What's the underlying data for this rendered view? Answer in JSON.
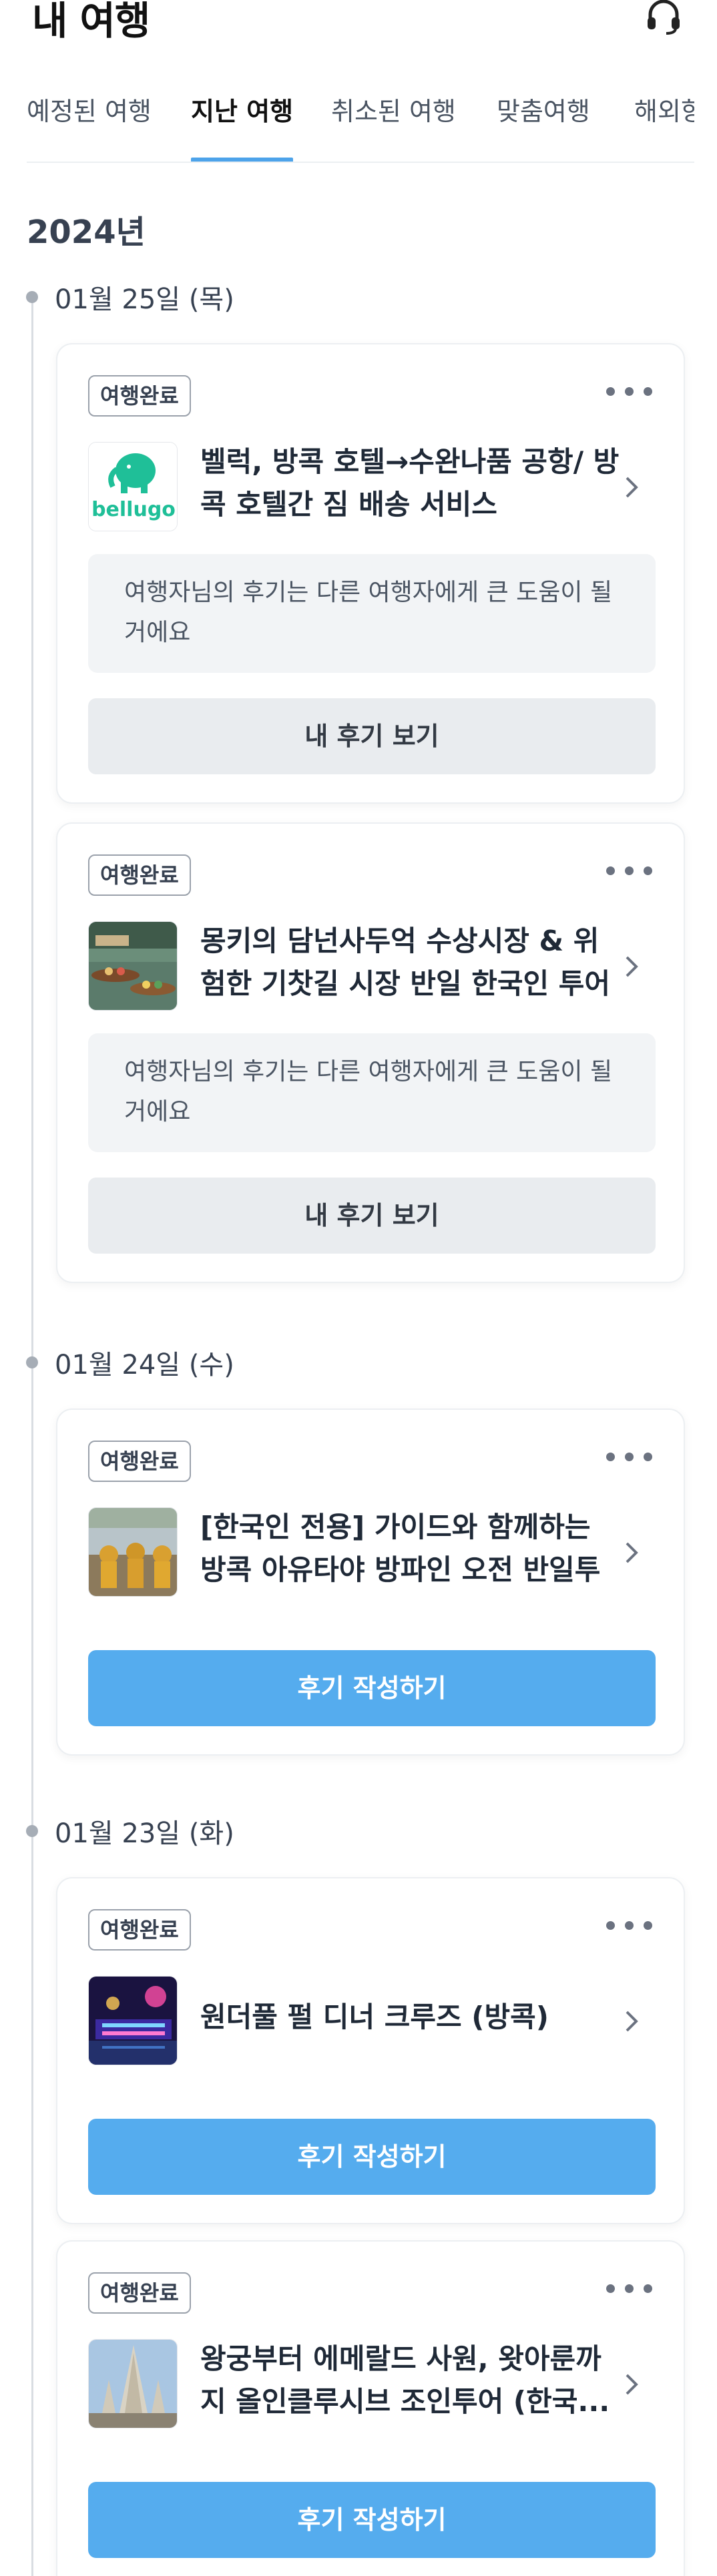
{
  "header": {
    "title": "내 여행",
    "support_icon": "headset-icon"
  },
  "tabs": [
    {
      "label": "예정된 여행",
      "active": false
    },
    {
      "label": "지난 여행",
      "active": true
    },
    {
      "label": "취소된 여행",
      "active": false
    },
    {
      "label": "맞춤여행",
      "active": false
    },
    {
      "label": "해외항공",
      "active": false
    }
  ],
  "year": "2024년",
  "groups": [
    {
      "date": "01월 25일 (목)",
      "trips": [
        {
          "badge": "여행완료",
          "title": "벨럭, 방콕 호텔→수완나품 공항/ 방콕 호텔간 짐 배송 서비스",
          "notice": "여행자님의 후기는 다른 여행자에게 큰 도움이 될 거에요",
          "button": "내 후기 보기",
          "thumb": "bellugo-logo",
          "logo_text": "bellugo"
        },
        {
          "badge": "여행완료",
          "title": "몽키의 담넌사두억 수상시장 & 위험한 기찻길 시장 반일 한국인 투어 (...",
          "notice": "여행자님의 후기는 다른 여행자에게 큰 도움이 될 거에요",
          "button": "내 후기 보기",
          "thumb": "floating-market-photo"
        }
      ]
    },
    {
      "date": "01월 24일 (수)",
      "trips": [
        {
          "badge": "여행완료",
          "title": "[한국인 전용] 가이드와 함께하는 방콕 아유타야 방파인 오전 반일투어",
          "button": "후기 작성하기",
          "thumb": "ayutthaya-buddha-photo"
        }
      ]
    },
    {
      "date": "01월 23일 (화)",
      "trips": [
        {
          "badge": "여행완료",
          "title": "원더풀 펄 디너 크루즈 (방콕)",
          "button": "후기 작성하기",
          "thumb": "dinner-cruise-photo"
        },
        {
          "badge": "여행완료",
          "title": "왕궁부터 에메랄드 사원, 왓아룬까지 올인클루시브 조인투어 (한국...",
          "button": "후기 작성하기",
          "thumb": "wat-arun-photo"
        }
      ]
    }
  ],
  "colors": {
    "accent_blue": "#55acee",
    "tab_indicator": "#4da3ea",
    "gray_button": "#e9ecef",
    "notice_bg": "#f2f4f6",
    "bellugo_green": "#1fbf98"
  }
}
